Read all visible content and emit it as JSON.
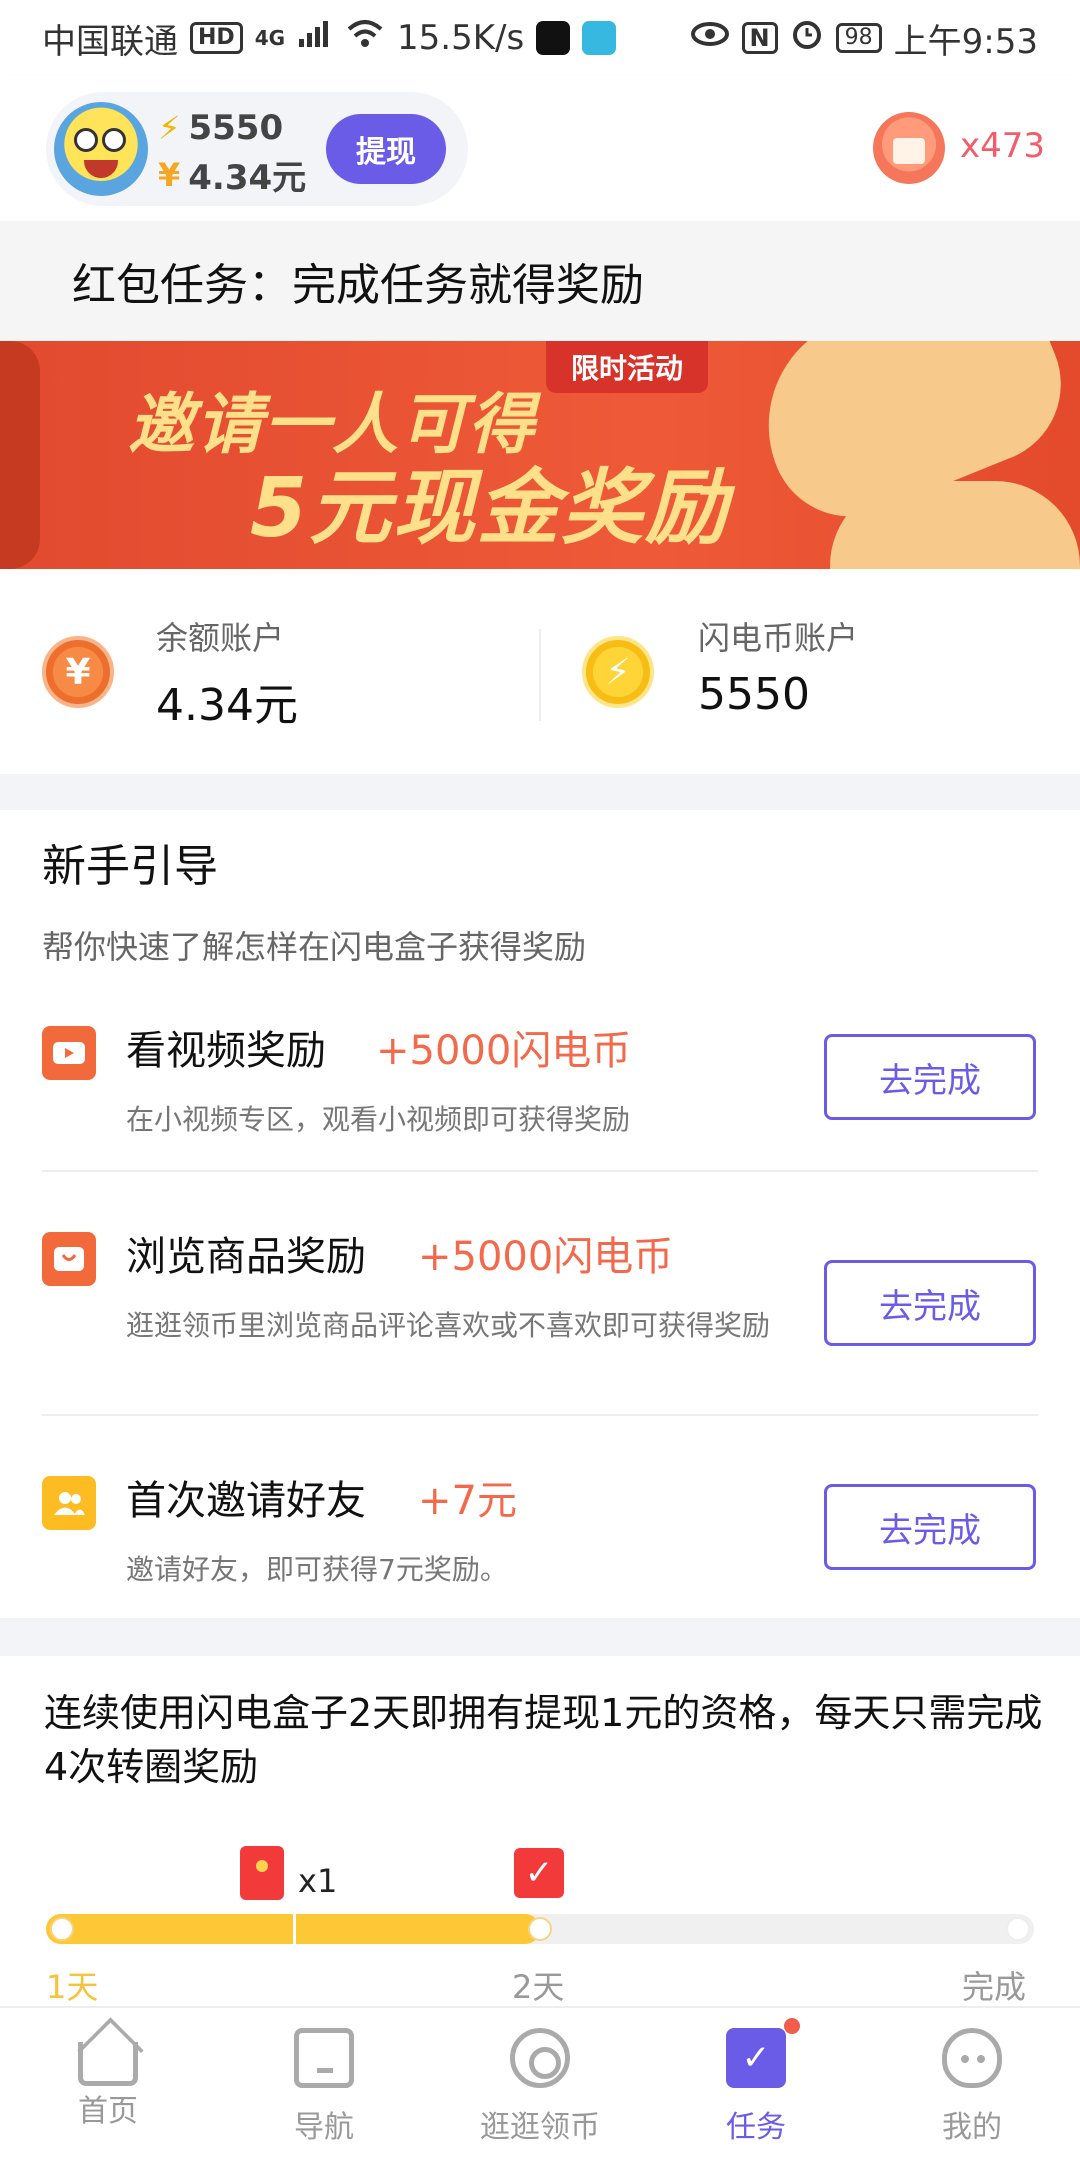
{
  "status_bar": {
    "carrier": "中国联通",
    "hd": "HD",
    "network": "4G",
    "speed": "15.5K/s",
    "battery": "98",
    "time": "上午9:53",
    "icons": [
      "signal-icon",
      "wifi-icon",
      "tiktok-app-icon",
      "book-app-icon",
      "eye-comfort-icon",
      "nfc-icon",
      "alarm-icon",
      "battery-icon"
    ]
  },
  "header": {
    "coins": "5550",
    "balance": "4.34元",
    "withdraw_label": "提现",
    "redpack_count": "x473"
  },
  "title_strip": "红包任务：完成任务就得奖励",
  "banner": {
    "tag": "限时活动",
    "line1": "邀请一人可得",
    "line2": "5元现金奖励"
  },
  "accounts": {
    "balance_label": "余额账户",
    "balance_value": "4.34元",
    "coin_label": "闪电币账户",
    "coin_value": "5550",
    "yuan_glyph": "¥",
    "bolt_glyph": "⚡"
  },
  "guide": {
    "title": "新手引导",
    "subtitle": "帮你快速了解怎样在闪电盒子获得奖励",
    "tasks": [
      {
        "name": "看视频奖励",
        "reward": "+5000闪电币",
        "desc": "在小视频专区，观看小视频即可获得奖励",
        "button": "去完成",
        "icon": "video-icon"
      },
      {
        "name": "浏览商品奖励",
        "reward": "+5000闪电币",
        "desc": "逛逛领币里浏览商品评论喜欢或不喜欢即可获得奖励",
        "button": "去完成",
        "icon": "shopping-icon"
      },
      {
        "name": "首次邀请好友",
        "reward": "+7元",
        "desc": "邀请好友，即可获得7元奖励。",
        "button": "去完成",
        "icon": "friends-icon"
      }
    ]
  },
  "streak": {
    "text": "连续使用闪电盒子2天即拥有提现1元的资格，每天只需完成4次转圈奖励",
    "progress": 0.5,
    "redpack_count": "x1",
    "check_glyph": "✓",
    "labels": [
      "1天",
      "2天",
      "完成"
    ]
  },
  "nav": {
    "items": [
      {
        "label": "首页",
        "icon": "home-icon"
      },
      {
        "label": "导航",
        "icon": "navigation-icon"
      },
      {
        "label": "逛逛领币",
        "icon": "browse-icon"
      },
      {
        "label": "任务",
        "icon": "task-icon",
        "active": true
      },
      {
        "label": "我的",
        "icon": "profile-icon"
      }
    ],
    "task_check": "✓"
  },
  "colors": {
    "accent": "#6b5ce7",
    "reward": "#f26a4b",
    "progress": "#fdc736"
  }
}
